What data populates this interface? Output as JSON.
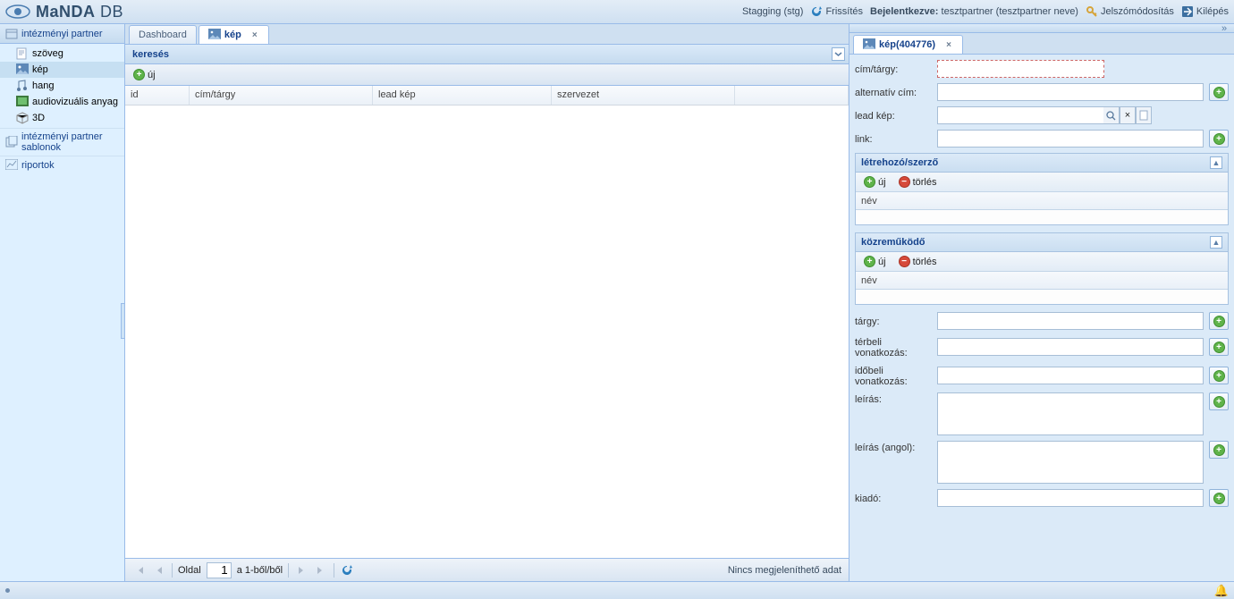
{
  "header": {
    "brand_bold": "MaNDA",
    "brand_light": " DB",
    "env": "Stagging (stg)",
    "refresh": "Frissítés",
    "logged_in_prefix": "Bejelentkezve:",
    "logged_in_user": "tesztpartner (tesztpartner neve)",
    "pwchange": "Jelszómódosítás",
    "logout": "Kilépés"
  },
  "sidebar": {
    "header": "intézményi partner",
    "items": [
      {
        "label": "szöveg",
        "icon": "doc"
      },
      {
        "label": "kép",
        "icon": "image",
        "selected": true
      },
      {
        "label": "hang",
        "icon": "audio"
      },
      {
        "label": "audiovizuális anyag",
        "icon": "film"
      },
      {
        "label": "3D",
        "icon": "cube"
      }
    ],
    "section2": "intézményi partner sablonok",
    "section3": "riportok"
  },
  "tabs": {
    "dashboard": "Dashboard",
    "kep": "kép"
  },
  "search": {
    "title": "keresés",
    "new": "új",
    "cols": {
      "id": "id",
      "title": "cím/tárgy",
      "lead": "lead kép",
      "org": "szervezet"
    }
  },
  "paging": {
    "page_label": "Oldal",
    "page_value": "1",
    "of_suffix": "a 1-ből/ből",
    "status": "Nincs megjeleníthető adat"
  },
  "right": {
    "tab_title": "kép(404776)",
    "fields": {
      "cim": "cím/tárgy:",
      "alt": "alternatív cím:",
      "lead": "lead kép:",
      "link": "link:",
      "targy": "tárgy:",
      "terbeli": "térbeli vonatkozás:",
      "idobeli": "időbeli vonatkozás:",
      "leiras": "leírás:",
      "leiras_en": "leírás (angol):",
      "kiado": "kiadó:"
    },
    "sub_creator": {
      "title": "létrehozó/szerző",
      "new": "új",
      "del": "törlés",
      "col": "név"
    },
    "sub_contrib": {
      "title": "közreműködő",
      "new": "új",
      "del": "törlés",
      "col": "név"
    }
  }
}
